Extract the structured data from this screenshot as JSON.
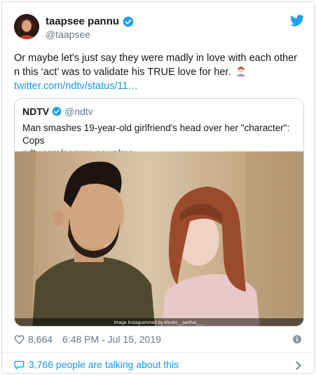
{
  "tweet": {
    "author_name": "taapsee pannu",
    "author_handle": "@taapsee",
    "text": "Or maybe let's just say they were madly in love with each other n this ‘act’ was to validate his TRUE love for her.",
    "emoji": "woman-facepalming-emoji",
    "link": "twitter.com/ndtv/status/11…",
    "likes": "8,664",
    "timestamp": "6:48 PM - Jul 15, 2019",
    "talking": "3,766 people are talking about this"
  },
  "quoted": {
    "author_name": "NDTV",
    "author_handle": "@ndtv",
    "headline": "Man smashes 19-year-old girlfriend's head over her \"character\": Cops",
    "link": "ndtv.com/nagpur-news/ma…",
    "photo_credit": "Image Instagrammed by khushi__parihar___"
  },
  "colors": {
    "link_blue": "#1b95e0",
    "secondary_gray": "#657786",
    "verified_blue": "#1da1f2"
  },
  "icons": [
    "verified-badge-icon",
    "twitter-bird-icon",
    "heart-icon",
    "info-icon",
    "speech-bubble-icon",
    "chevron-right-icon"
  ]
}
